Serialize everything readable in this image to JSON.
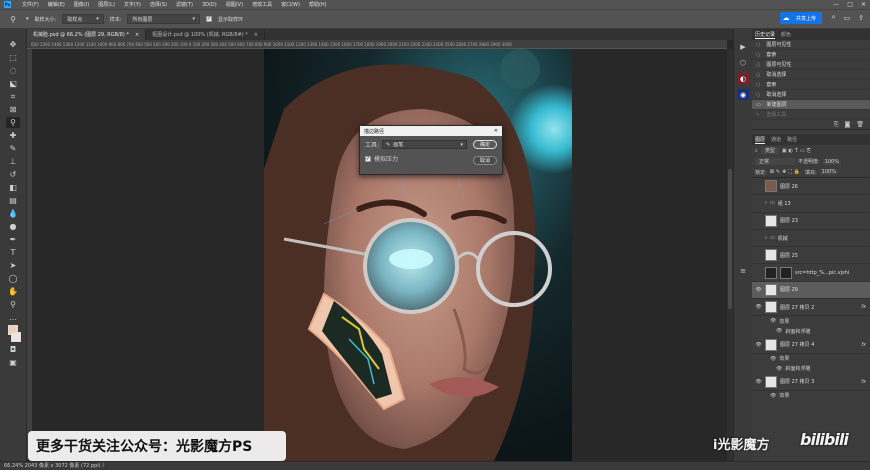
{
  "menu": {
    "items": [
      "文件(F)",
      "编辑(E)",
      "图像(I)",
      "图层(L)",
      "文字(Y)",
      "选择(S)",
      "滤镜(T)",
      "3D(D)",
      "视图(V)",
      "增效工具",
      "窗口(W)",
      "帮助(H)"
    ],
    "window_controls": [
      "—",
      "□",
      "✕"
    ]
  },
  "options": {
    "sample_size_label": "取样大小:",
    "sample_size_value": "取样点",
    "sample_label": "样本:",
    "sample_value": "所有图层",
    "show_ring_label": "显示取样环",
    "share_label": "共享上传",
    "icons": [
      "search-icon",
      "panel-icon",
      "share-icon"
    ]
  },
  "tabs": [
    {
      "label": "机械脸.psd @ 66.2% (图层 29, RGB/8) *",
      "close": "×"
    },
    {
      "label": "抠图设计.psd @ 100% (机械, RGB/8#) *",
      "close": "×"
    }
  ],
  "ruler": {
    "ticks": "600 1500 1400 1300 1200 1100 1000 900 800 700 600 500 400 300 200 100 0 100 200 300 400 500 600 700 800 900 1000 1100 1200 1300 1400 1500 1600 1700 1800 1900 2000 2100 2200 2300 2400 2500 2600 2700 2800 2900 3000"
  },
  "dialog": {
    "title": "描边路径",
    "close": "✕",
    "tool_label": "工具:",
    "tool_value": "画笔",
    "simulate_pressure_label": "模拟压力",
    "ok_label": "确定",
    "cancel_label": "取消"
  },
  "history": {
    "tabs": [
      "历史记录",
      "颜色"
    ],
    "items": [
      {
        "label": "图层可见性",
        "selected": false,
        "dim": false
      },
      {
        "label": "套索",
        "selected": false,
        "dim": false
      },
      {
        "label": "图层可见性",
        "selected": false,
        "dim": false
      },
      {
        "label": "取消选择",
        "selected": false,
        "dim": false
      },
      {
        "label": "套索",
        "selected": false,
        "dim": false
      },
      {
        "label": "取消选择",
        "selected": false,
        "dim": false
      },
      {
        "label": "新建图层",
        "selected": true,
        "dim": false
      },
      {
        "label": "选择工具",
        "selected": false,
        "dim": true
      }
    ]
  },
  "layers": {
    "tabs": [
      "图层",
      "通道",
      "路径"
    ],
    "kind_label": "类型",
    "blend_label": "正常",
    "opacity_label": "不透明度:",
    "opacity_value": "100%",
    "lock_label": "锁定:",
    "fill_label": "填充:",
    "fill_value": "100%",
    "rows": [
      {
        "name": "图层 26",
        "eye": "",
        "thumb": "photo",
        "fx": "",
        "selected": false
      },
      {
        "name": "组 13",
        "eye": "",
        "thumb": "folder",
        "fx": "",
        "selected": false
      },
      {
        "name": "图层 23",
        "eye": "",
        "thumb": "white",
        "fx": "",
        "selected": false
      },
      {
        "name": "机械",
        "eye": "",
        "thumb": "folder",
        "fx": "",
        "selected": false
      },
      {
        "name": "图层 25",
        "eye": "",
        "thumb": "white",
        "fx": "",
        "selected": false
      },
      {
        "name": "src=http_%...pic.vjshi",
        "eye": "",
        "thumb": "dark",
        "fx": "",
        "selected": false
      },
      {
        "name": "图层 29",
        "eye": "👁",
        "thumb": "white",
        "fx": "",
        "selected": true
      },
      {
        "name": "图层 27 拷贝 2",
        "eye": "👁",
        "thumb": "white",
        "fx": "fx",
        "selected": false
      }
    ],
    "effects_a": [
      "效果",
      "斜面和浮雕"
    ],
    "row_b": {
      "name": "图层 27 拷贝 4",
      "eye": "👁",
      "fx": "fx"
    },
    "effects_b": [
      "效果",
      "斜面和浮雕"
    ],
    "row_c": {
      "name": "图层 27 拷贝 3",
      "eye": "👁",
      "fx": "fx"
    },
    "effects_c": [
      "效果"
    ]
  },
  "status": {
    "text": "66.24%   2043 像素 x 3072 像素 (72 ppi)   〉"
  },
  "overlay": {
    "watermark": "更多干货关注公众号：光影魔方PS",
    "brand": "i光影魔方",
    "bili": "bilibili"
  },
  "colors": {
    "accent": "#1473e6",
    "fg_swatch": "#e8cfbf",
    "bg_swatch": "#f2e3d8"
  }
}
